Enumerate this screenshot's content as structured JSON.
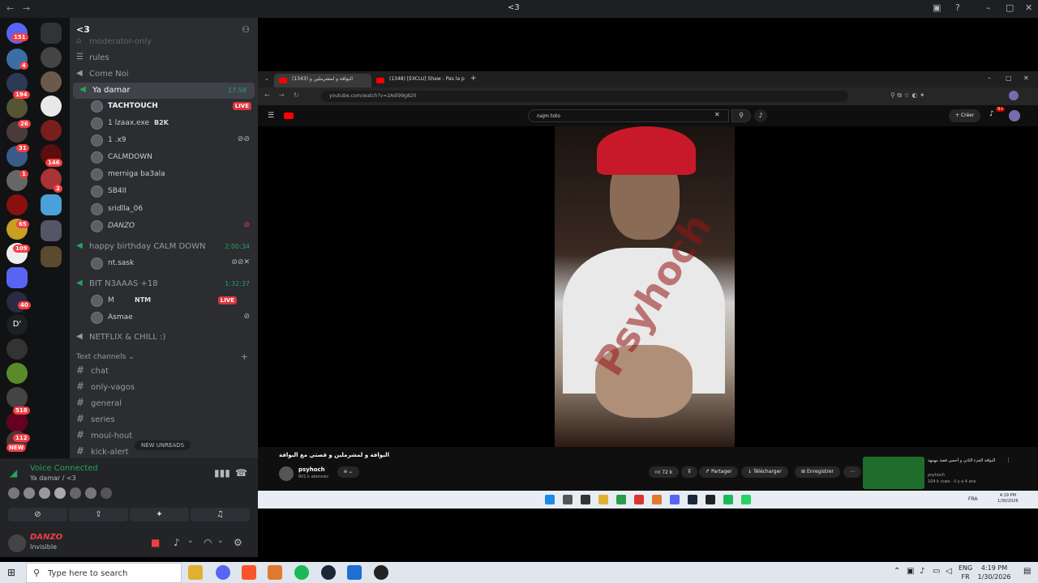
{
  "window": {
    "title": "<3",
    "back": "←",
    "forward": "→"
  },
  "server": {
    "name": "<3"
  },
  "server_badges": [
    "151",
    "4",
    "194",
    "26",
    "31",
    "1",
    "146",
    "2",
    "65",
    "109",
    "40",
    "518",
    "112",
    "NEW"
  ],
  "server_letter": "D'",
  "channels": {
    "top_faded": "moderator-only",
    "rules": "rules",
    "come_noi": "Come Noi",
    "ya_damar": {
      "label": "Ya damar",
      "time": "17:58"
    },
    "ya_damar_users": [
      {
        "name": "TACHTOUCH",
        "badge": "LIVE"
      },
      {
        "name": "1 lzaax.exe",
        "tag": "B2K"
      },
      {
        "name": "1 .x9"
      },
      {
        "name": "CALMDOWN"
      },
      {
        "name": "merniga ba3ala"
      },
      {
        "name": "SB4II"
      },
      {
        "name": "sridlla_06"
      },
      {
        "name": "DANZO"
      }
    ],
    "birthday": {
      "label": "happy birthday CALM DOWN",
      "time": "2:00:34"
    },
    "birthday_users": [
      {
        "name": "nt.sask"
      }
    ],
    "bit": {
      "label": "BIT N3AAAS +18",
      "time": "1:32:37"
    },
    "bit_users": [
      {
        "name": "M",
        "tag": "NTM",
        "badge": "LIVE"
      },
      {
        "name": "Asmae"
      }
    ],
    "netflix": "NETFLIX & CHILL :)",
    "text_category": "Text channels",
    "text_channels": [
      "chat",
      "only-vagos",
      "general",
      "series",
      "moul-hout",
      "kick-alert"
    ],
    "new_unreads": "NEW UNREADS"
  },
  "voice": {
    "status": "Voice Connected",
    "location": "Ya damar / <3"
  },
  "user": {
    "name": "DANZO",
    "status": "Invisible"
  },
  "browser": {
    "tab1": "البوافة و لمشرملين و (1343)",
    "tab2": "(1348) [EXCLU] Shaw - Pas la p",
    "url": "youtube.com/watch?v=2Adi99g820",
    "search": "najm toto",
    "create": "Créer",
    "notif_count": "9+",
    "watermark": "Psyhoch",
    "video_title": "البوافة و لمشرملين و قصتي مع البوافة",
    "channel_name": "psyhoch",
    "subscribers": "601 k abonnés",
    "likes": "72 k",
    "share": "Partager",
    "download": "Télécharger",
    "save": "Enregistrer",
    "reco_title": "البوافة الجزء الثاني و أحسن قصة مهمهة",
    "reco_channel": "psyhoch",
    "reco_meta": "104 k vues · il y a 4 ans",
    "inner_lang": "FRA",
    "inner_time": "4:19 PM",
    "inner_date": "1/30/2026"
  },
  "taskbar": {
    "search_placeholder": "Type here to search",
    "lang_top": "ENG",
    "lang_bottom": "FR",
    "time": "4:19 PM",
    "date": "1/30/2026"
  }
}
